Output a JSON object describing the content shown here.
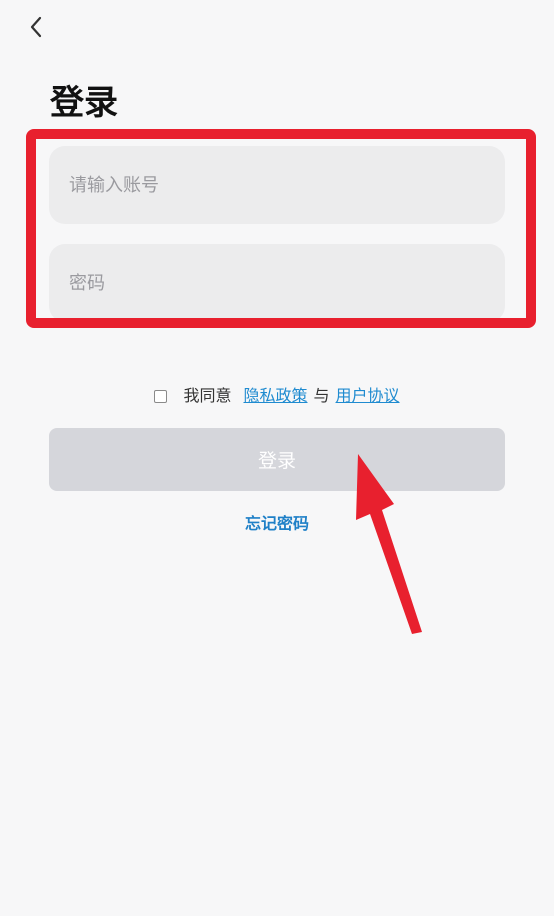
{
  "header": {
    "back_icon": "chevron-left-icon",
    "title": "登录"
  },
  "form": {
    "account_placeholder": "请输入账号",
    "account_value": "",
    "password_placeholder": "密码",
    "password_value": ""
  },
  "agreement": {
    "checked": false,
    "prefix": "我同意",
    "privacy_link": "隐私政策",
    "connector": "与",
    "terms_link": "用户协议"
  },
  "actions": {
    "login_label": "登录",
    "forgot_password": "忘记密码"
  },
  "colors": {
    "background": "#f7f7f8",
    "input_background": "#ececed",
    "highlight": "#e8202e",
    "link": "#1f8bd0",
    "login_button_disabled": "#d5d6db"
  }
}
